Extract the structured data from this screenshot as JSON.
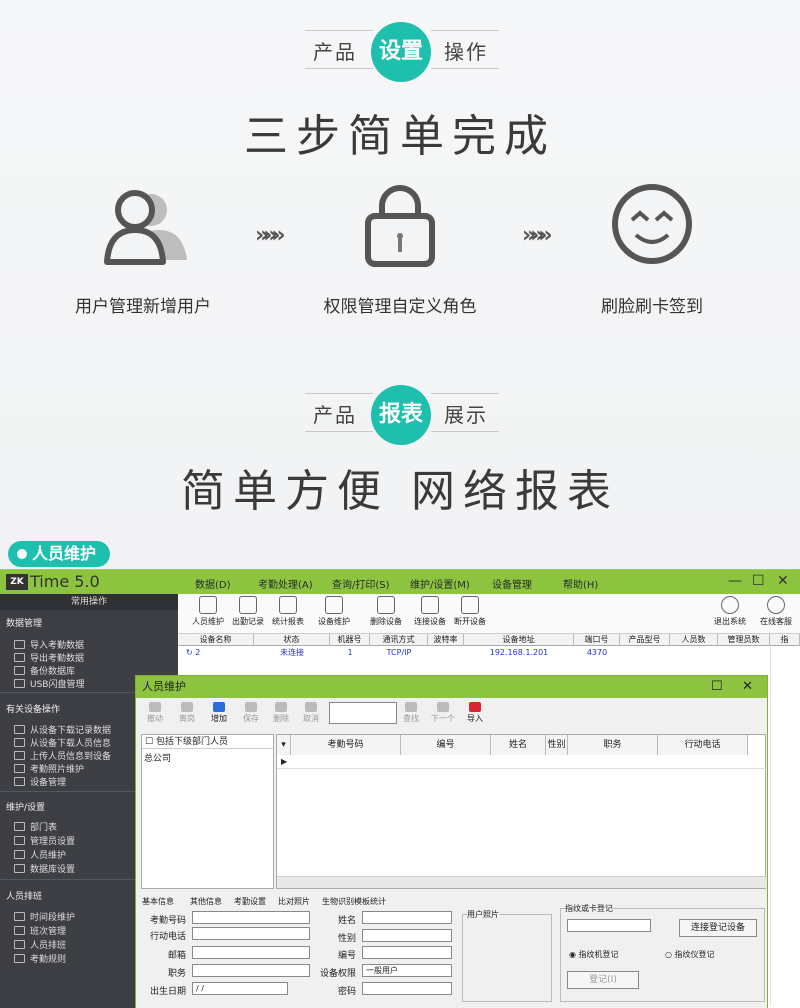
{
  "section1": {
    "left": "产品",
    "pill": "设置",
    "right": "操作",
    "headline": "三步简单完成"
  },
  "steps": [
    {
      "icon": "users-icon",
      "label": "用户管理新增用户"
    },
    {
      "icon": "lock-icon",
      "label": "权限管理自定义角色"
    },
    {
      "icon": "smile-face-icon",
      "label": "刷脸刷卡签到"
    }
  ],
  "arrow": "»»»",
  "section2": {
    "left": "产品",
    "pill": "报表",
    "right": "展示",
    "headline": "简单方便 网络报表"
  },
  "tag": "人员维护",
  "app": {
    "logo": "ZK",
    "title": "Time 5.0",
    "menu": [
      "数据(D)",
      "考勤处理(A)",
      "查询/打印(S)",
      "维护/设置(M)",
      "设备管理",
      "帮助(H)"
    ],
    "window_controls": [
      "—",
      "☐",
      "✕"
    ],
    "sidebar": {
      "head": "常用操作",
      "groups": [
        {
          "title": "数据管理",
          "items": [
            "导入考勤数据",
            "导出考勤数据",
            "备份数据库",
            "USB闪盘管理"
          ]
        },
        {
          "title": "有关设备操作",
          "items": [
            "从设备下载记录数据",
            "从设备下载人员信息",
            "上传人员信息到设备",
            "考勤照片维护",
            "设备管理"
          ]
        },
        {
          "title": "维护/设置",
          "items": [
            "部门表",
            "管理员设置",
            "人员维护",
            "数据库设置"
          ]
        },
        {
          "title": "人员排班",
          "items": [
            "时间段维护",
            "班次管理",
            "人员排班",
            "考勤规则"
          ]
        }
      ]
    },
    "toolbar": [
      "人员维护",
      "出勤记录",
      "统计报表",
      "设备维护",
      "删除设备",
      "连接设备",
      "断开设备",
      "退出系统",
      "在线客服"
    ],
    "grid_headers": [
      "设备名称",
      "状态",
      "机器号",
      "通讯方式",
      "波特率",
      "设备地址",
      "端口号",
      "产品型号",
      "人员数",
      "管理员数",
      "指"
    ],
    "grid_row": [
      "2",
      "未连接",
      "1",
      "TCP/IP",
      "",
      "192.168.1.201",
      "4370"
    ]
  },
  "dialog": {
    "title": "人员维护",
    "toolbar": [
      "撤动",
      "离岗",
      "增加",
      "保存",
      "删除",
      "取消",
      "查找",
      "下一个",
      "导入"
    ],
    "toolbar_active": [
      false,
      false,
      true,
      false,
      false,
      false,
      false,
      false,
      true
    ],
    "tree_check": "包括下级部门人员",
    "tree_root": "总公司",
    "grid_headers": [
      "考勤号码",
      "编号",
      "姓名",
      "性别",
      "职务",
      "行动电话"
    ],
    "tabs": [
      "基本信息",
      "其他信息",
      "考勤设置",
      "比对照片",
      "生物识别模板统计"
    ],
    "form_left": [
      "考勤号码",
      "行动电话",
      "邮箱",
      "职务",
      "出生日期"
    ],
    "birth_value": "/ /",
    "form_mid": [
      "姓名",
      "性别",
      "编号",
      "设备权限",
      "密码"
    ],
    "device_perm_value": "一般用户",
    "photo_label": "用户照片",
    "fp_label": "指纹或卡登记",
    "connect_btn": "连接登记设备",
    "radio1": "指纹机登记",
    "radio2": "指纹仪登记",
    "register_btn": "登记(I)"
  }
}
